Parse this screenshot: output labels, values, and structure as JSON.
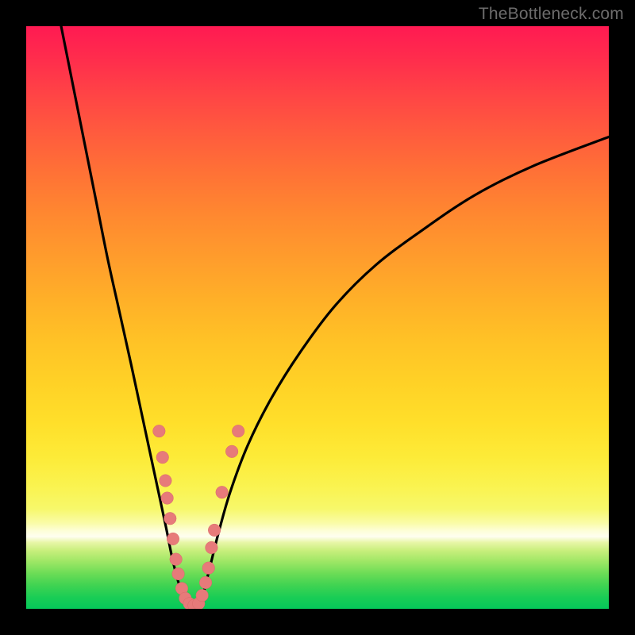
{
  "watermark": "TheBottleneck.com",
  "colors": {
    "frame": "#000000",
    "curve": "#000000",
    "dot_fill": "#e77a7a",
    "dot_stroke": "#d86a6a"
  },
  "chart_data": {
    "type": "line",
    "title": "",
    "xlabel": "",
    "ylabel": "",
    "xlim": [
      0,
      100
    ],
    "ylim": [
      0,
      100
    ],
    "series": [
      {
        "name": "left-branch",
        "x": [
          6.0,
          8.0,
          10.0,
          12.0,
          14.0,
          16.0,
          18.0,
          19.5,
          21.0,
          22.5,
          24.0,
          25.0,
          26.0,
          27.0,
          27.8
        ],
        "y": [
          100,
          90,
          80,
          70,
          60,
          51,
          42,
          35,
          28,
          21,
          14,
          9,
          5,
          2,
          0.5
        ]
      },
      {
        "name": "right-branch",
        "x": [
          29.8,
          30.5,
          31.5,
          33.0,
          35.0,
          38.0,
          42.0,
          47.0,
          53.0,
          60.0,
          68.0,
          77.0,
          87.0,
          100.0
        ],
        "y": [
          0.5,
          3,
          7,
          13,
          20,
          28,
          36,
          44,
          52,
          59,
          65,
          71,
          76,
          81
        ]
      }
    ],
    "dots": {
      "name": "data-points",
      "points": [
        {
          "x": 22.8,
          "y": 30.5
        },
        {
          "x": 23.4,
          "y": 26.0
        },
        {
          "x": 23.9,
          "y": 22.0
        },
        {
          "x": 24.2,
          "y": 19.0
        },
        {
          "x": 24.7,
          "y": 15.5
        },
        {
          "x": 25.2,
          "y": 12.0
        },
        {
          "x": 25.7,
          "y": 8.5
        },
        {
          "x": 26.1,
          "y": 6.0
        },
        {
          "x": 26.7,
          "y": 3.5
        },
        {
          "x": 27.3,
          "y": 1.8
        },
        {
          "x": 28.0,
          "y": 0.9
        },
        {
          "x": 28.8,
          "y": 0.6
        },
        {
          "x": 29.6,
          "y": 0.9
        },
        {
          "x": 30.2,
          "y": 2.3
        },
        {
          "x": 30.8,
          "y": 4.5
        },
        {
          "x": 31.3,
          "y": 7.0
        },
        {
          "x": 31.8,
          "y": 10.5
        },
        {
          "x": 32.3,
          "y": 13.5
        },
        {
          "x": 33.6,
          "y": 20.0
        },
        {
          "x": 35.3,
          "y": 27.0
        },
        {
          "x": 36.4,
          "y": 30.5
        }
      ]
    }
  }
}
